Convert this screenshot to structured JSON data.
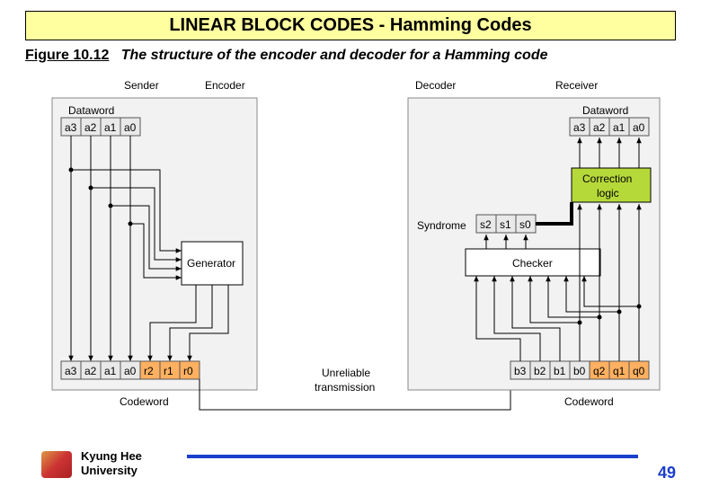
{
  "title": "LINEAR BLOCK CODES - Hamming Codes",
  "figure": {
    "number": "Figure 10.12",
    "caption": "The structure of the encoder and decoder for a Hamming code"
  },
  "sender": {
    "title": "Sender",
    "dataword_label": "Dataword",
    "dataword": [
      "a3",
      "a2",
      "a1",
      "a0"
    ],
    "encoder_label": "Encoder",
    "generator_label": "Generator",
    "codeword_label": "Codeword",
    "codeword": [
      "a3",
      "a2",
      "a1",
      "a0",
      "r2",
      "r1",
      "r0"
    ]
  },
  "channel": {
    "label_top": "Unreliable",
    "label_bottom": "transmission"
  },
  "receiver": {
    "title": "Receiver",
    "decoder_label": "Decoder",
    "dataword_label": "Dataword",
    "dataword": [
      "a3",
      "a2",
      "a1",
      "a0"
    ],
    "correction_label1": "Correction",
    "correction_label2": "logic",
    "syndrome_label": "Syndrome",
    "syndrome": [
      "s2",
      "s1",
      "s0"
    ],
    "checker_label": "Checker",
    "codeword_label": "Codeword",
    "codeword": [
      "b3",
      "b2",
      "b1",
      "b0",
      "q2",
      "q1",
      "q0"
    ]
  },
  "footer": {
    "university1": "Kyung Hee",
    "university2": "University",
    "page": "49"
  }
}
